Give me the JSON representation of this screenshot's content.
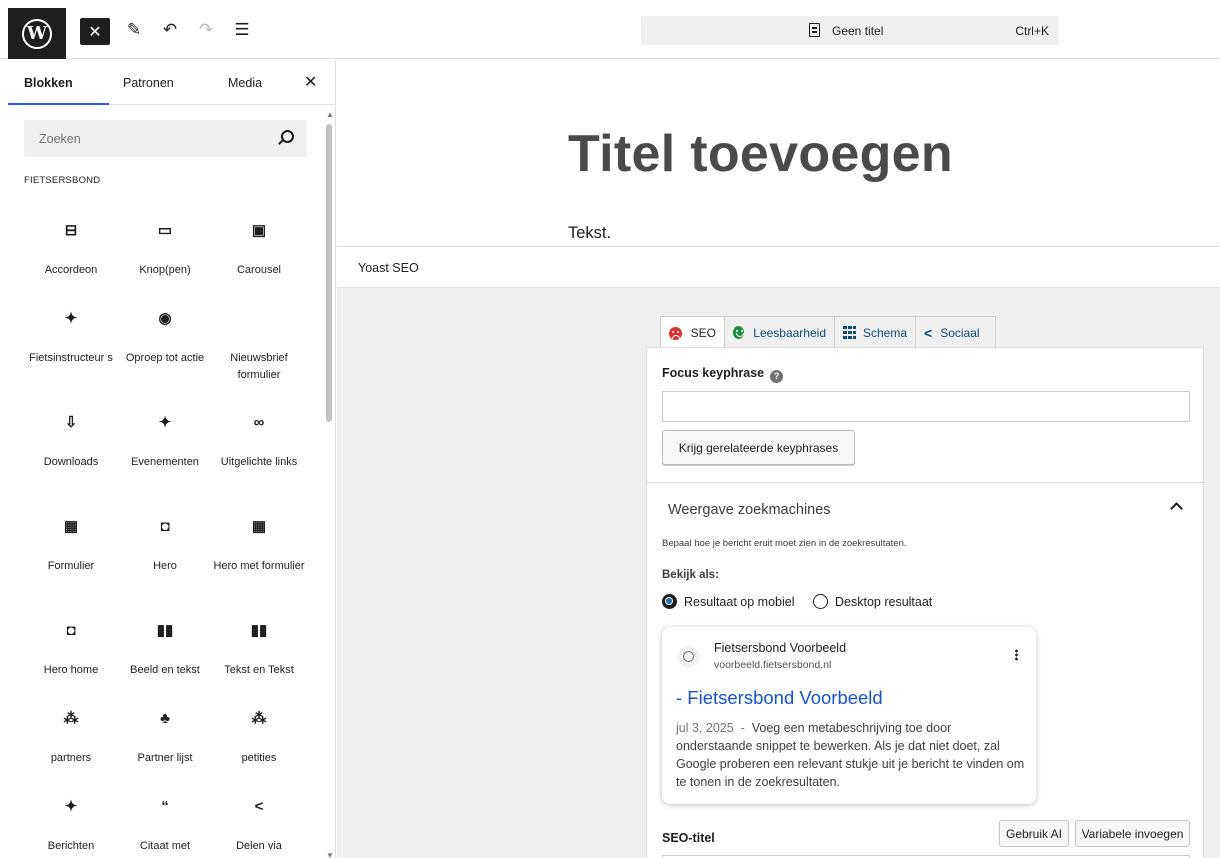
{
  "toolbar": {
    "logo_icon": "wordpress-logo-icon",
    "doc_title": "Geen titel",
    "doc_shortcut": "Ctrl+K"
  },
  "inserter": {
    "tabs": [
      "Blokken",
      "Patronen",
      "Media"
    ],
    "active_tab": "Blokken",
    "search_placeholder": "Zoeken",
    "category": "FIETSERSBOND",
    "blocks": [
      {
        "label": "Accordeon",
        "icon": "accordion-icon",
        "glyph": "⊟"
      },
      {
        "label": "Knop(pen)",
        "icon": "button-icon",
        "glyph": "▭"
      },
      {
        "label": "Carousel",
        "icon": "carousel-icon",
        "glyph": "▣"
      },
      {
        "label": "Fietsinstructeur s",
        "icon": "pin-icon",
        "glyph": "✦"
      },
      {
        "label": "Oproep tot actie",
        "icon": "megaphone-icon",
        "glyph": "◉"
      },
      {
        "label": "Nieuwsbrief formulier",
        "icon": "",
        "glyph": ""
      },
      {
        "label": "Downloads",
        "icon": "download-icon",
        "glyph": "⇩"
      },
      {
        "label": "Evenementen",
        "icon": "pin-icon",
        "glyph": "✦"
      },
      {
        "label": "Uitgelichte links",
        "icon": "link-icon",
        "glyph": "∞"
      },
      {
        "label": "Formulier",
        "icon": "form-icon",
        "glyph": "▦"
      },
      {
        "label": "Hero",
        "icon": "hero-icon",
        "glyph": "◘"
      },
      {
        "label": "Hero met formulier",
        "icon": "form-icon",
        "glyph": "▦"
      },
      {
        "label": "Hero home",
        "icon": "hero-icon",
        "glyph": "◘"
      },
      {
        "label": "Beeld en tekst",
        "icon": "columns-icon",
        "glyph": "▮▮"
      },
      {
        "label": "Tekst en Tekst",
        "icon": "columns-icon",
        "glyph": "▮▮"
      },
      {
        "label": "partners",
        "icon": "group-icon",
        "glyph": "⁂"
      },
      {
        "label": "Partner lijst",
        "icon": "users-icon",
        "glyph": "♣"
      },
      {
        "label": "petities",
        "icon": "group-icon",
        "glyph": "⁂"
      },
      {
        "label": "Berichten",
        "icon": "pin-icon",
        "glyph": "✦"
      },
      {
        "label": "Citaat met",
        "icon": "quote-icon",
        "glyph": "“"
      },
      {
        "label": "Delen via",
        "icon": "share-icon",
        "glyph": "<"
      }
    ]
  },
  "editor": {
    "title_placeholder": "Titel toevoegen",
    "paragraph": "Tekst."
  },
  "yoast": {
    "panel_title": "Yoast SEO",
    "tabs": [
      "SEO",
      "Leesbaarheid",
      "Schema",
      "Sociaal"
    ],
    "focus_label": "Focus keyphrase",
    "focus_value": "",
    "related_button": "Krijg gerelateerde keyphrases",
    "section_title": "Weergave zoekmachines",
    "section_desc": "Bepaal hoe je bericht eruit moet zien in de zoekresultaten.",
    "view_as": "Bekijk als:",
    "radio_mobile": "Resultaat op mobiel",
    "radio_desktop": "Desktop resultaat",
    "selected_view": "Resultaat op mobiel",
    "snippet": {
      "site_name": "Fietsersbond Voorbeeld",
      "site_url": "voorbeeld.fietsersbond.nl",
      "title": "- Fietsersbond Voorbeeld",
      "date": "jul 3, 2025",
      "description": "Voeg een metabeschrijving toe door onderstaande snippet te bewerken. Als je dat niet doet, zal Google proberen een relevant stukje uit je bericht te vinden om te tonen in de zoekresultaten."
    },
    "seo_title_label": "SEO-titel",
    "ai_button": "Gebruik AI",
    "variable_button": "Variabele invoegen"
  }
}
